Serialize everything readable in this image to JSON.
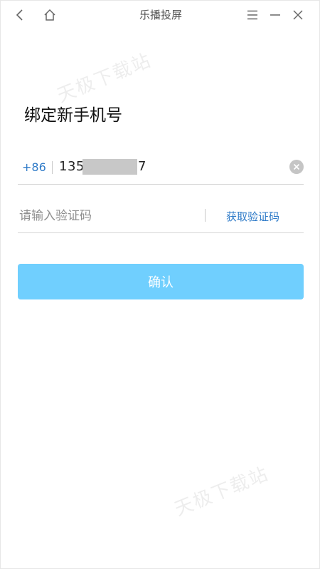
{
  "titlebar": {
    "title": "乐播投屏",
    "icons": {
      "back": "chevron-left-icon",
      "home": "home-icon",
      "menu": "menu-icon",
      "minimize": "minimize-icon",
      "close": "close-icon"
    }
  },
  "watermark": {
    "text": "天极下载站"
  },
  "page": {
    "heading": "绑定新手机号"
  },
  "phone": {
    "country_code": "+86",
    "prefix": "135",
    "suffix": "7",
    "clear_icon": "clear-circle-icon"
  },
  "code": {
    "placeholder": "请输入验证码",
    "value": "",
    "get_code_label": "获取验证码"
  },
  "confirm": {
    "label": "确认",
    "color": "#70cffe"
  },
  "colors": {
    "accent": "#2f7bc8",
    "divider": "#d7d7d7"
  }
}
